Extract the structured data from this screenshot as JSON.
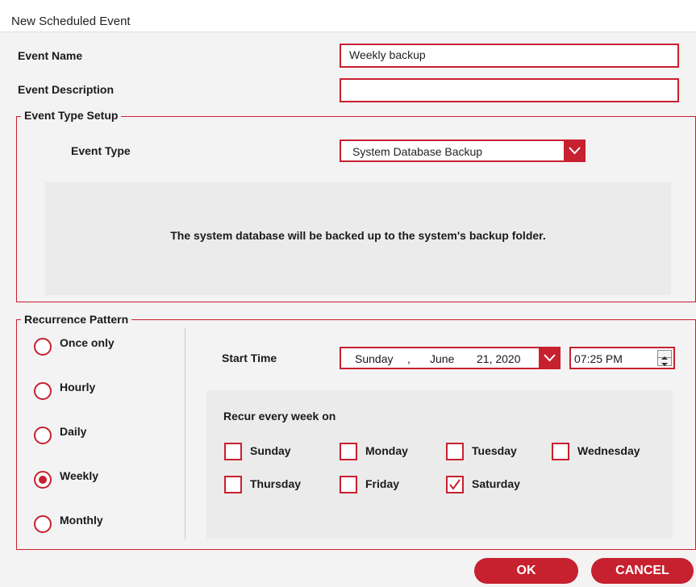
{
  "window": {
    "title": "New Scheduled Event"
  },
  "form": {
    "event_name_label": "Event Name",
    "event_name_value": "Weekly backup",
    "event_description_label": "Event Description",
    "event_description_value": ""
  },
  "event_type_setup": {
    "group_title": "Event Type Setup",
    "event_type_label": "Event Type",
    "event_type_value": "System Database Backup",
    "info_message": "The system database will be backed up to the system's backup folder."
  },
  "recurrence": {
    "group_title": "Recurrence Pattern",
    "options": [
      {
        "label": "Once only",
        "selected": false
      },
      {
        "label": "Hourly",
        "selected": false
      },
      {
        "label": "Daily",
        "selected": false
      },
      {
        "label": "Weekly",
        "selected": true
      },
      {
        "label": "Monthly",
        "selected": false
      }
    ],
    "start_time_label": "Start Time",
    "date": {
      "weekday": "Sunday",
      "sep": ",",
      "month": "June",
      "day_year": "21, 2020"
    },
    "time_value": "07:25 PM",
    "recur_label": "Recur every week on",
    "days": [
      {
        "label": "Sunday",
        "checked": false
      },
      {
        "label": "Monday",
        "checked": false
      },
      {
        "label": "Tuesday",
        "checked": false
      },
      {
        "label": "Wednesday",
        "checked": false
      },
      {
        "label": "Thursday",
        "checked": false
      },
      {
        "label": "Friday",
        "checked": false
      },
      {
        "label": "Saturday",
        "checked": true
      }
    ]
  },
  "buttons": {
    "ok": "OK",
    "cancel": "CANCEL"
  },
  "colors": {
    "accent": "#c7202f",
    "background": "#f3f3f3",
    "panel": "#ebebeb"
  }
}
